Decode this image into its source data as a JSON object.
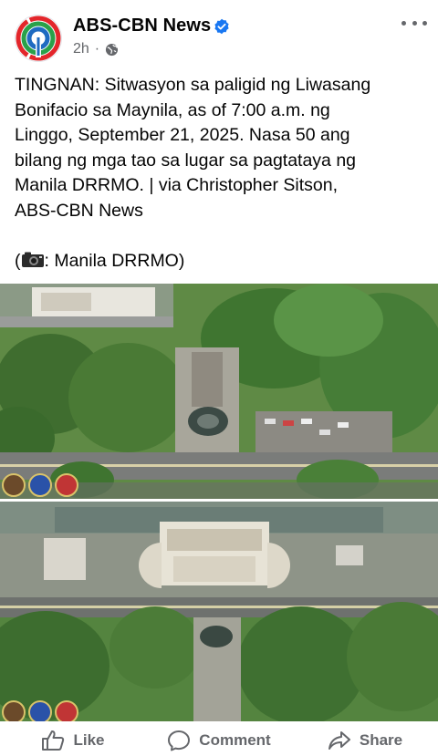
{
  "post": {
    "page_name": "ABS-CBN News",
    "time": "2h",
    "privacy_icon": "globe-icon",
    "verified_icon": "verified-badge-icon",
    "more_icon": "more-options-icon",
    "caption_lines": [
      "TINGNAN: Sitwasyon sa paligid ng Liwasang",
      "Bonifacio sa Maynila, as of 7:00 a.m. ng",
      "Linggo, September 21, 2025. Nasa 50 ang",
      "bilang ng mga tao sa lugar sa pagtataya ng",
      "Manila DRRMO. | via Christopher Sitson,",
      "ABS-CBN News"
    ],
    "credit_open": "(",
    "credit_icon": "camera-icon",
    "credit_text": ": Manila DRRMO)"
  },
  "actions": {
    "like": "Like",
    "comment": "Comment",
    "share": "Share"
  }
}
